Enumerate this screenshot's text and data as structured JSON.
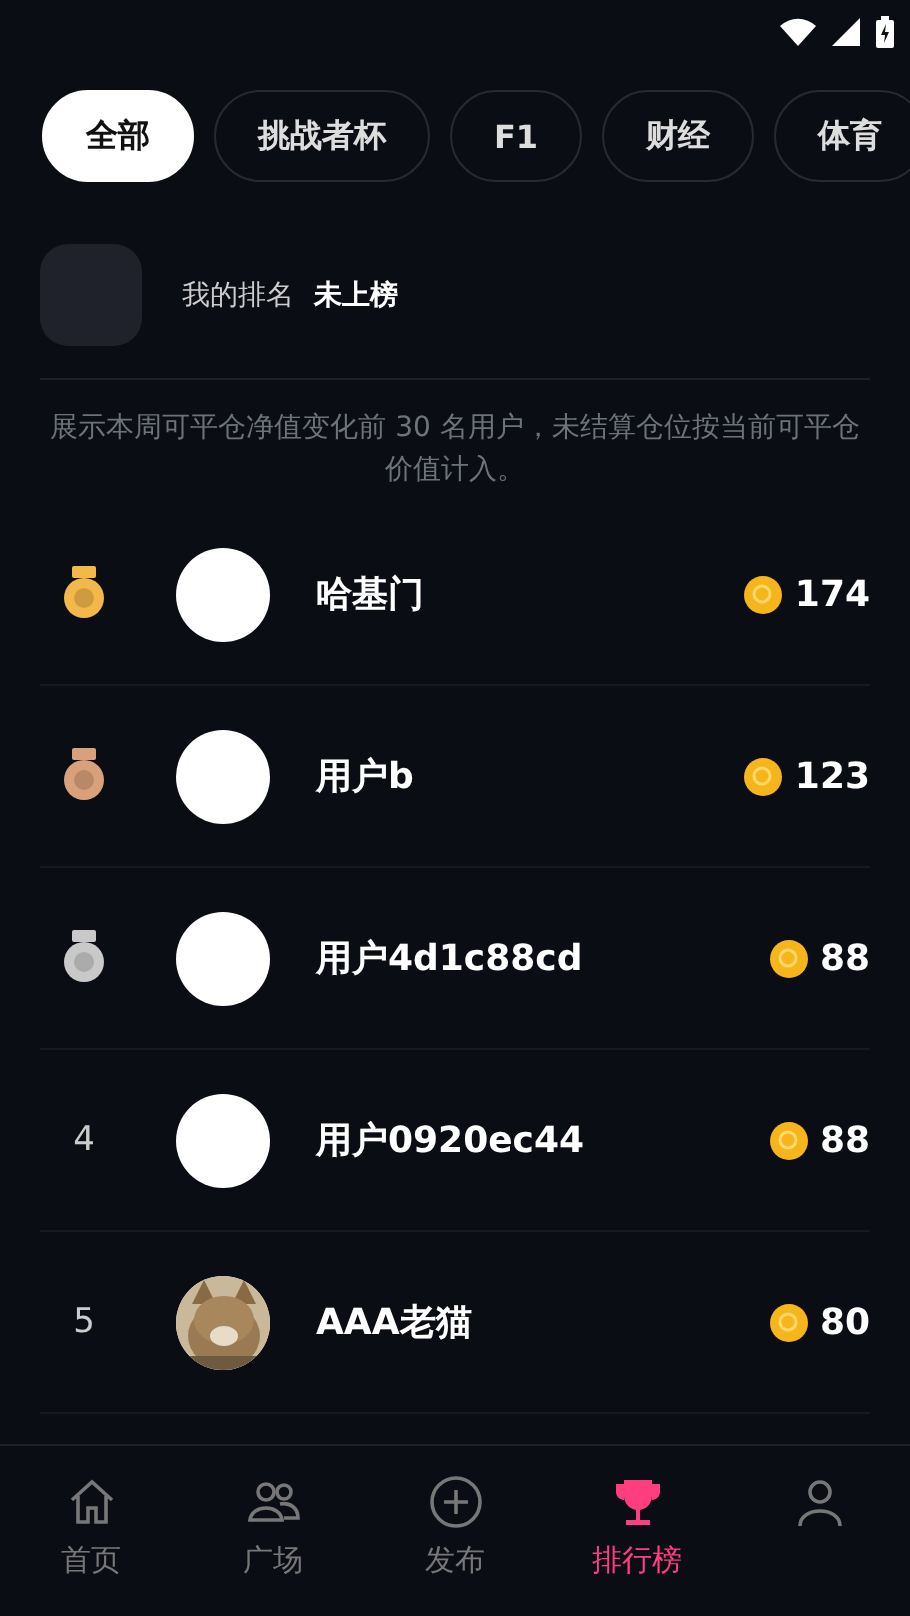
{
  "tabs": [
    {
      "label": "全部",
      "selected": true
    },
    {
      "label": "挑战者杯",
      "selected": false
    },
    {
      "label": "F1",
      "selected": false
    },
    {
      "label": "财经",
      "selected": false
    },
    {
      "label": "体育",
      "selected": false
    }
  ],
  "my_rank": {
    "label": "我的排名",
    "value": "未上榜"
  },
  "note": "展示本周可平仓净值变化前 30 名用户，未结算仓位按当前可平仓价值计入。",
  "rows": [
    {
      "kind": "medal",
      "color": "#f3b84a",
      "avatar": {
        "kind": "default"
      },
      "name": "哈基门",
      "points": "174"
    },
    {
      "kind": "medal",
      "color": "#d9a07c",
      "avatar": {
        "kind": "default"
      },
      "name": "用户b",
      "points": "123"
    },
    {
      "kind": "medal",
      "color": "#c9c9c9",
      "avatar": {
        "kind": "default"
      },
      "name": "用户4d1c88cd",
      "points": "88"
    },
    {
      "kind": "number",
      "rank": "4",
      "avatar": {
        "kind": "default"
      },
      "name": "用户0920ec44",
      "points": "88"
    },
    {
      "kind": "number",
      "rank": "5",
      "name": "AAA老猫",
      "points": "80"
    }
  ],
  "nav": [
    {
      "label": "首页",
      "selected": false
    },
    {
      "label": "广场",
      "selected": false
    },
    {
      "label": "发布",
      "selected": false
    },
    {
      "label": "排行榜",
      "selected": true
    },
    {
      "selected": false
    }
  ]
}
